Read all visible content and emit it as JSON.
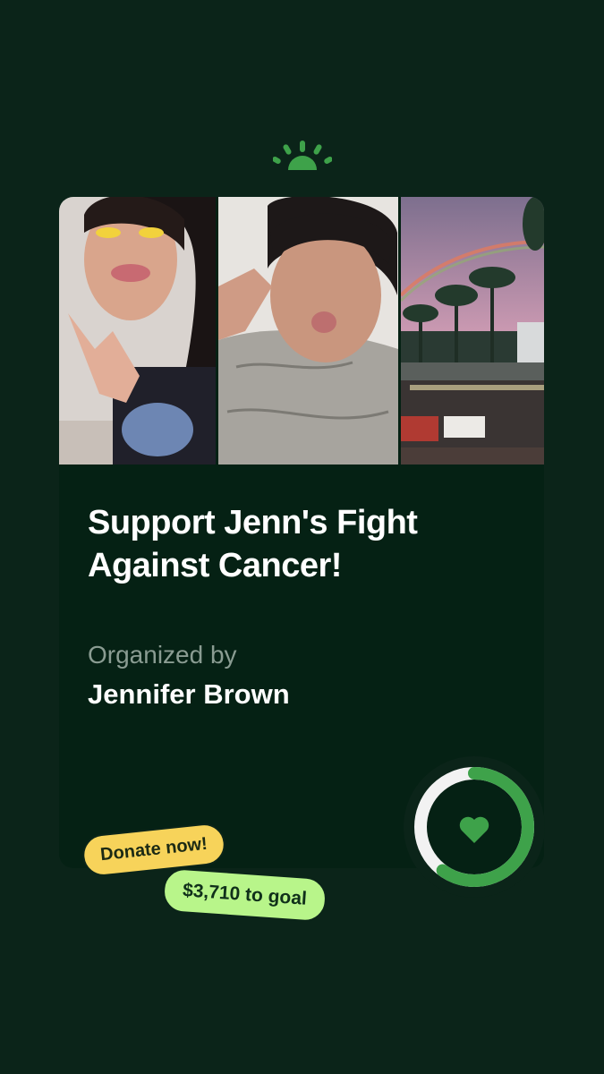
{
  "brand": {
    "logo_icon": "gofundme-sunrise-icon",
    "accent": "#3ea24a"
  },
  "photos": [
    {
      "icon": "photo-woman-peace-sign",
      "alt": ""
    },
    {
      "icon": "photo-woman-hospital-bed",
      "alt": ""
    },
    {
      "icon": "photo-hospital-palm-trees-rainbow",
      "alt": ""
    }
  ],
  "campaign": {
    "title": "Support Jenn's Fight Against Cancer!",
    "organized_label": "Organized by",
    "organizer": "Jennifer Brown"
  },
  "progress": {
    "fraction": 0.6,
    "color": "#3ea24a",
    "track_color": "#f2f2f2",
    "icon": "heart-icon"
  },
  "cta": {
    "donate_label": "Donate now!",
    "goal_label": "$3,710 to goal"
  }
}
